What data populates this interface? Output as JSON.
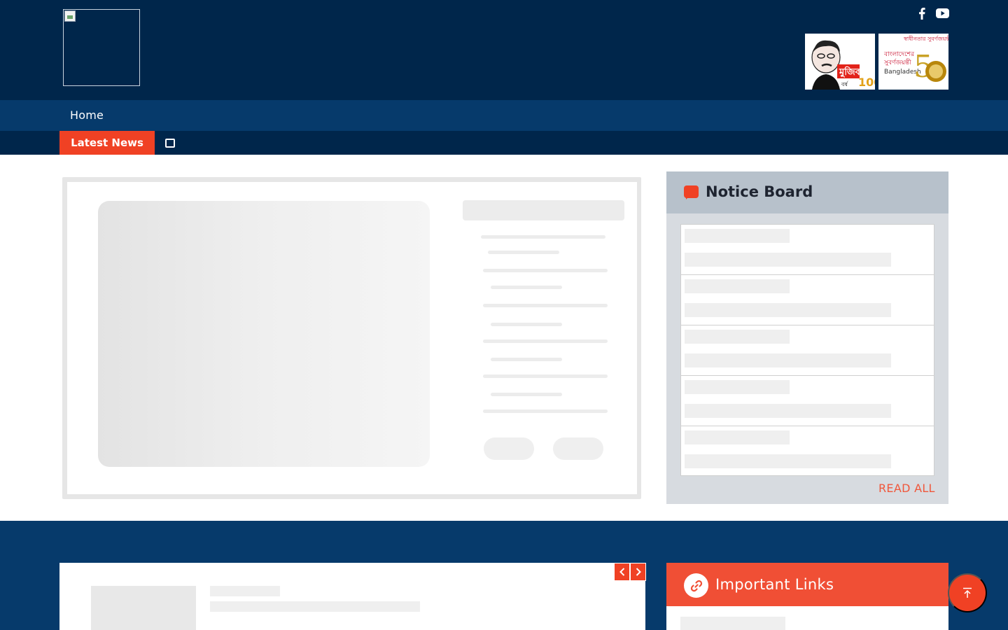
{
  "header": {
    "logo_alt": "",
    "social": [
      {
        "name": "facebook-icon"
      },
      {
        "name": "youtube-icon"
      }
    ],
    "badges": [
      {
        "name": "mujib-100-badge",
        "text": "মুজিব বর্ষ 100"
      },
      {
        "name": "bangladesh-50-badge",
        "text": "Bangladesh 50"
      }
    ]
  },
  "nav": {
    "items": [
      {
        "label": "Home"
      }
    ]
  },
  "ticker": {
    "label": "Latest News"
  },
  "notice_board": {
    "title": "Notice Board",
    "read_all": "READ ALL"
  },
  "important_links": {
    "title": "Important Links"
  },
  "colors": {
    "primary_dark": "#00264b",
    "primary": "#063a6b",
    "accent": "#f04124"
  }
}
